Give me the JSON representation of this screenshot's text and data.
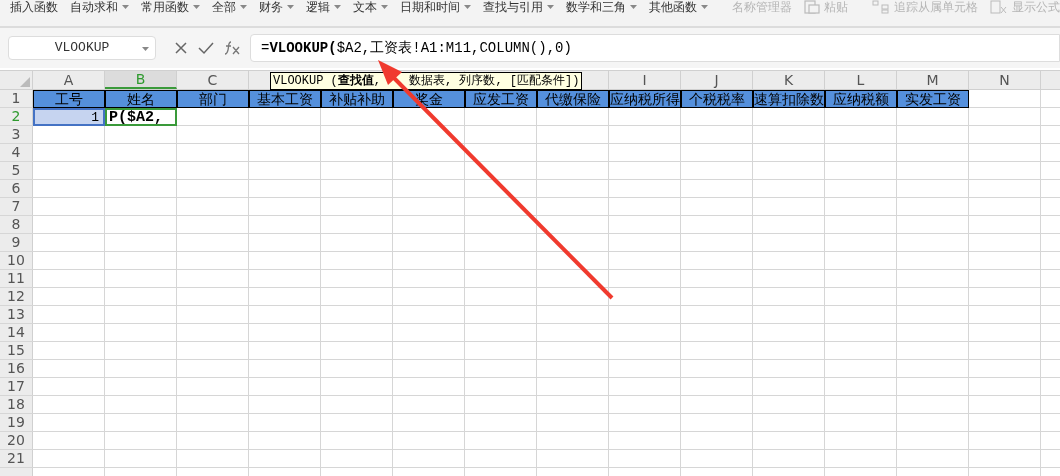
{
  "toolbar": {
    "items": [
      {
        "label": "插入函数",
        "dropdown": false,
        "disabled": false
      },
      {
        "label": "自动求和",
        "dropdown": true,
        "disabled": false
      },
      {
        "label": "常用函数",
        "dropdown": true,
        "disabled": false
      },
      {
        "label": "全部",
        "dropdown": true,
        "disabled": false
      },
      {
        "label": "财务",
        "dropdown": true,
        "disabled": false
      },
      {
        "label": "逻辑",
        "dropdown": true,
        "disabled": false
      },
      {
        "label": "文本",
        "dropdown": true,
        "disabled": false
      },
      {
        "label": "日期和时间",
        "dropdown": true,
        "disabled": false
      },
      {
        "label": "查找与引用",
        "dropdown": true,
        "disabled": false
      },
      {
        "label": "数学和三角",
        "dropdown": true,
        "disabled": false
      },
      {
        "label": "其他函数",
        "dropdown": true,
        "disabled": false
      },
      {
        "kind": "separator"
      },
      {
        "label": "名称管理器",
        "dropdown": false,
        "disabled": true
      },
      {
        "label": "粘贴",
        "dropdown": false,
        "disabled": true,
        "kind": "icon_button"
      },
      {
        "kind": "separator"
      },
      {
        "label": "追踪从属单元格",
        "dropdown": false,
        "disabled": true,
        "kind": "icon_button"
      },
      {
        "label": "显示公式",
        "dropdown": false,
        "disabled": true,
        "kind": "icon_button"
      }
    ]
  },
  "formula_bar": {
    "name_box": "VLOOKUP",
    "formula": "=**VLOOKUP(**$A2,工资表!A1:M11,COLUMN(),0)"
  },
  "tooltip": [
    "VLOOKUP (**查找值**,",
    "数据表, 列序数, [匹配条件])"
  ],
  "sheet": {
    "columns": [
      {
        "letter": "A",
        "selected": false
      },
      {
        "letter": "B",
        "selected": true
      },
      {
        "letter": "C",
        "selected": false
      },
      {},
      {},
      {},
      {},
      {},
      {
        "letter": "I",
        "selected": false
      },
      {
        "letter": "J",
        "selected": false
      },
      {
        "letter": "K",
        "selected": false
      },
      {
        "letter": "L",
        "selected": false
      },
      {
        "letter": "M",
        "selected": false
      },
      {
        "letter": "N",
        "selected": false
      }
    ],
    "rows": [
      {
        "number": "1",
        "selected": false,
        "cells": [
          {
            "text": "工号",
            "kind": "header"
          },
          {
            "text": "姓名",
            "kind": "header"
          },
          {
            "text": "部门",
            "kind": "header"
          },
          {
            "text": "基本工资",
            "kind": "header"
          },
          {
            "text": "补贴补助",
            "kind": "header"
          },
          {
            "text": "奖金",
            "kind": "header"
          },
          {
            "text": "应发工资",
            "kind": "header"
          },
          {
            "text": "代缴保险",
            "kind": "header"
          },
          {
            "text": "应纳税所得",
            "kind": "header"
          },
          {
            "text": "个税税率",
            "kind": "header"
          },
          {
            "text": "速算扣除数",
            "kind": "header"
          },
          {
            "text": "应纳税额",
            "kind": "header"
          },
          {
            "text": "实发工资",
            "kind": "header"
          }
        ]
      },
      {
        "number": "2",
        "selected": true,
        "cells": [
          {
            "text": "1",
            "kind": "number"
          },
          {
            "text": "P($A2,",
            "kind": "editing"
          }
        ]
      },
      {
        "number": "3",
        "selected": false
      },
      {
        "number": "4",
        "selected": false
      },
      {
        "number": "5",
        "selected": false
      },
      {
        "number": "6",
        "selected": false
      },
      {
        "number": "7",
        "selected": false
      },
      {
        "number": "8",
        "selected": false
      },
      {
        "number": "9",
        "selected": false
      },
      {
        "number": "10",
        "selected": false
      },
      {
        "number": "11",
        "selected": false
      },
      {
        "number": "12",
        "selected": false
      },
      {
        "number": "13",
        "selected": false
      },
      {
        "number": "14",
        "selected": false
      },
      {
        "number": "15",
        "selected": false
      },
      {
        "number": "16",
        "selected": false
      },
      {
        "number": "17",
        "selected": false
      },
      {
        "number": "18",
        "selected": false
      },
      {
        "number": "19",
        "selected": false
      },
      {
        "number": "20",
        "selected": false
      },
      {
        "number": "21",
        "selected": false
      }
    ]
  }
}
